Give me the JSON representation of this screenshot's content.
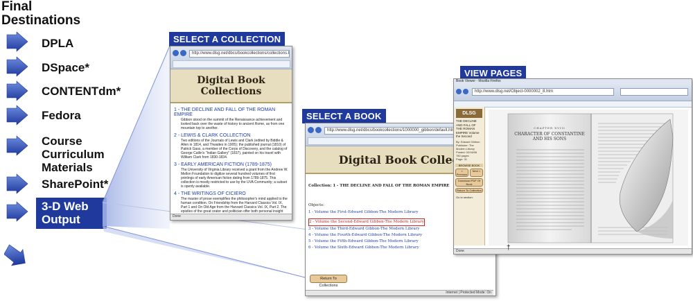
{
  "title": "Final\nDestinations",
  "destinations": [
    {
      "label": "DPLA"
    },
    {
      "label": "DSpace*"
    },
    {
      "label": "CONTENTdm*"
    },
    {
      "label": "Fedora"
    },
    {
      "label": "Course\nCurriculum\nMaterials"
    },
    {
      "label": "SharePoint*"
    },
    {
      "label": "3-D Web\nOutput",
      "highlighted": true
    }
  ],
  "colors": {
    "accent": "#1f3a9c",
    "arrow": "#2c4fc0",
    "banner": "#e7ddbf"
  },
  "panels": {
    "collection": {
      "tag": "SELECT A COLLECTION",
      "address": "http://www.dlsg.net/dbcs/bookcollections/collections.htm",
      "banner": "Digital Book Collections",
      "items": [
        {
          "title": "1 - THE DECLINE AND FALL OF THE ROMAN EMPIRE",
          "desc": "Gibbon stood on the summit of the Renaissance achievement and looked back over the waste of history to ancient Rome, as from one mountain top to another."
        },
        {
          "title": "2 - LEWIS & CLARK COLLECTION",
          "desc": "Two editions of the Journals of Lewis and Clark (edited by Biddle & Allen in 1814, and Thwaites in 1905); the published journal (1810) of Patrick Gass, a member of the Corps of Discovery, and the catalog of George Catlin's \"Indian Gallery\" (1837), painted on his travel with William Clark from 1830-1834."
        },
        {
          "title": "3 - EARLY AMERICAN FICTION (1789-1875)",
          "desc": "The University of Virginia Library received a grant from the Andrew W. Mellon Foundation to digitize several hundred volumes of first printings of early American fiction dating from 1789-1875. This collection is mostly restricted to use by the UVA Community; a subset is openly available."
        },
        {
          "title": "4 - THE WRITINGS OF CICIERO",
          "desc": "The master of prose exemplifies the philosopher's mind applied to the human condition. On Friendship from the Harvard Classics Vol. IX, Part 1 and On Old Age from the Harvard Classics Vol. IX, Part 2. The epistles of the great orator and politician offer both personal insight and policy initiative."
        }
      ],
      "status": "Done"
    },
    "book": {
      "tag": "SELECT A BOOK",
      "address": "http://www.dlsg.net/dbcs/bookcollections/1000000_gibbon/default.html",
      "banner": "Digital Book Collections",
      "collection_title": "Collection: 1 - THE DECLINE AND FALL OF THE ROMAN EMPIRE",
      "objects_label": "Objects:",
      "volumes": [
        "1 - Volume the First-Edward Gibbon-The Modern Library",
        "2 - Volume the Second-Edward Gibbon-The Modern Library",
        "3 - Volume the Third-Edward Gibbon-The Modern Library",
        "4 - Volume the Fourth-Edward Gibbon-The Modern Library",
        "5 - Volume the Fifth-Edward Gibbon-The Modern Library",
        "6 - Volume the Sixth-Edward Gibbon-The Modern Library"
      ],
      "return_button": "Return To Collections",
      "status": "Internet | Protected Mode: On"
    },
    "pages": {
      "tag": "VIEW PAGES",
      "window_title": "Book Viewer - Mozilla Firefox",
      "address": "http://www.dlsg.net/Object-0000002_8.htm",
      "logo": "DLSG",
      "book_title": "THE DECLINE AND FALL OF THE ROMAN EMPIRE Volume the Second",
      "book_meta": "By: Edward Gibbon\nPublisher: The Modern Library\nPosted: 02/16/06\n780 pages\nPage: 31",
      "browse_label": "BROWSE BOOK",
      "prev_button": "< Previous",
      "next_button": "Next >",
      "pdf_button": "Download PDF Of Book",
      "return_button": "Return To Collection",
      "goto_label": "Go to section:",
      "chapter_head": "CHAPTER XVIII",
      "chapter_title": "CHARACTER OF CONSTANTINE AND HIS SONS",
      "status": "Done"
    }
  }
}
